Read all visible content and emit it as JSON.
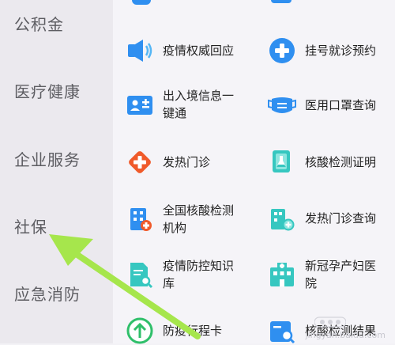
{
  "sidebar": {
    "items": [
      {
        "label": "公积金"
      },
      {
        "label": "医疗健康"
      },
      {
        "label": "企业服务"
      },
      {
        "label": "社保"
      },
      {
        "label": "应急消防"
      }
    ]
  },
  "services": [
    {
      "label": "疫情权威回应",
      "icon": "speaker-icon"
    },
    {
      "label": "挂号就诊预约",
      "icon": "medical-cross-icon"
    },
    {
      "label": "出入境信息一键通",
      "icon": "id-card-icon"
    },
    {
      "label": "医用口罩查询",
      "icon": "mask-icon"
    },
    {
      "label": "发热门诊",
      "icon": "fever-clinic-icon"
    },
    {
      "label": "核酸检测证明",
      "icon": "test-tube-icon"
    },
    {
      "label": "全国核酸检测机构",
      "icon": "hospital-building-icon"
    },
    {
      "label": "发热门诊查询",
      "icon": "hospital-search-icon"
    },
    {
      "label": "疫情防控知识库",
      "icon": "document-search-icon"
    },
    {
      "label": "新冠孕产妇医院",
      "icon": "maternity-hospital-icon"
    },
    {
      "label": "防疫行程卡",
      "icon": "arrow-up-circle-icon"
    },
    {
      "label": "核酸检测结果",
      "icon": "test-result-icon"
    }
  ],
  "watermark": {
    "text": "jingyan.baidu.com"
  },
  "colors": {
    "accent_blue": "#2f8ff0",
    "accent_orange": "#f05a2a",
    "accent_teal": "#36c7c0",
    "arrow_green": "#a6e64c"
  }
}
